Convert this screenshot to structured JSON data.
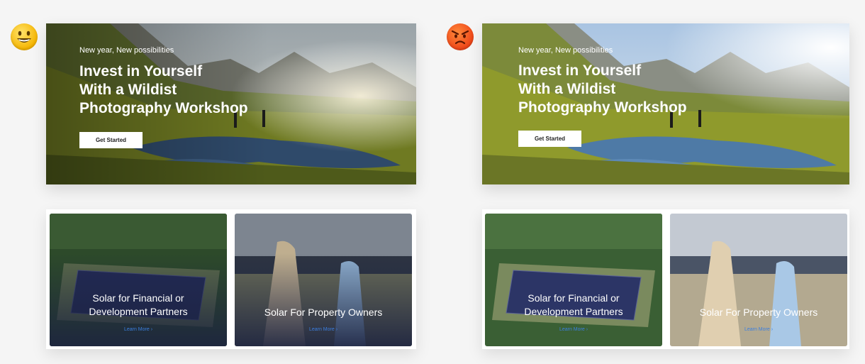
{
  "variants": {
    "good": {
      "hero": {
        "kicker": "New year, New possibilities",
        "headline": "Invest in Yourself\nWith a Wildist\nPhotography Workshop",
        "cta": "Get Started"
      },
      "cards": [
        {
          "title": "Solar for Financial or\nDevelopment Partners",
          "link": "Learn More ›"
        },
        {
          "title": "Solar For Property Owners",
          "link": "Learn More ›"
        }
      ]
    },
    "bad": {
      "hero": {
        "kicker": "New year, New possibilities",
        "headline": "Invest in Yourself\nWith a Wildist\nPhotography Workshop",
        "cta": "Get Started"
      },
      "cards": [
        {
          "title": "Solar for Financial or\nDevelopment Partners",
          "link": "Learn More ›"
        },
        {
          "title": "Solar For Property Owners",
          "link": "Learn More ›"
        }
      ]
    }
  },
  "icons": {
    "good": "grinning-face-icon",
    "bad": "angry-face-icon"
  },
  "colors": {
    "cta_bg": "#ffffff",
    "link": "#3b7fe0",
    "overlay_dark": "#1c2340"
  }
}
